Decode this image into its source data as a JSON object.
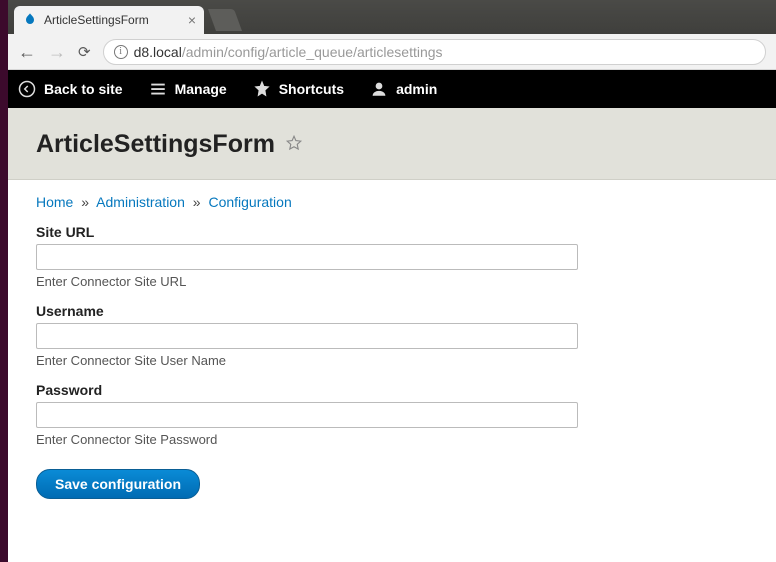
{
  "browser": {
    "tab_title": "ArticleSettingsForm",
    "url_host": "d8.local",
    "url_path": "/admin/config/article_queue/articlesettings"
  },
  "toolbar": {
    "back_label": "Back to site",
    "manage_label": "Manage",
    "shortcuts_label": "Shortcuts",
    "user_label": "admin"
  },
  "page": {
    "title": "ArticleSettingsForm"
  },
  "breadcrumb": {
    "home": "Home",
    "admin": "Administration",
    "config": "Configuration"
  },
  "form": {
    "site_url": {
      "label": "Site URL",
      "value": "",
      "desc": "Enter Connector Site URL"
    },
    "username": {
      "label": "Username",
      "value": "",
      "desc": "Enter Connector Site User Name"
    },
    "password": {
      "label": "Password",
      "value": "",
      "desc": "Enter Connector Site Password"
    },
    "submit_label": "Save configuration"
  }
}
